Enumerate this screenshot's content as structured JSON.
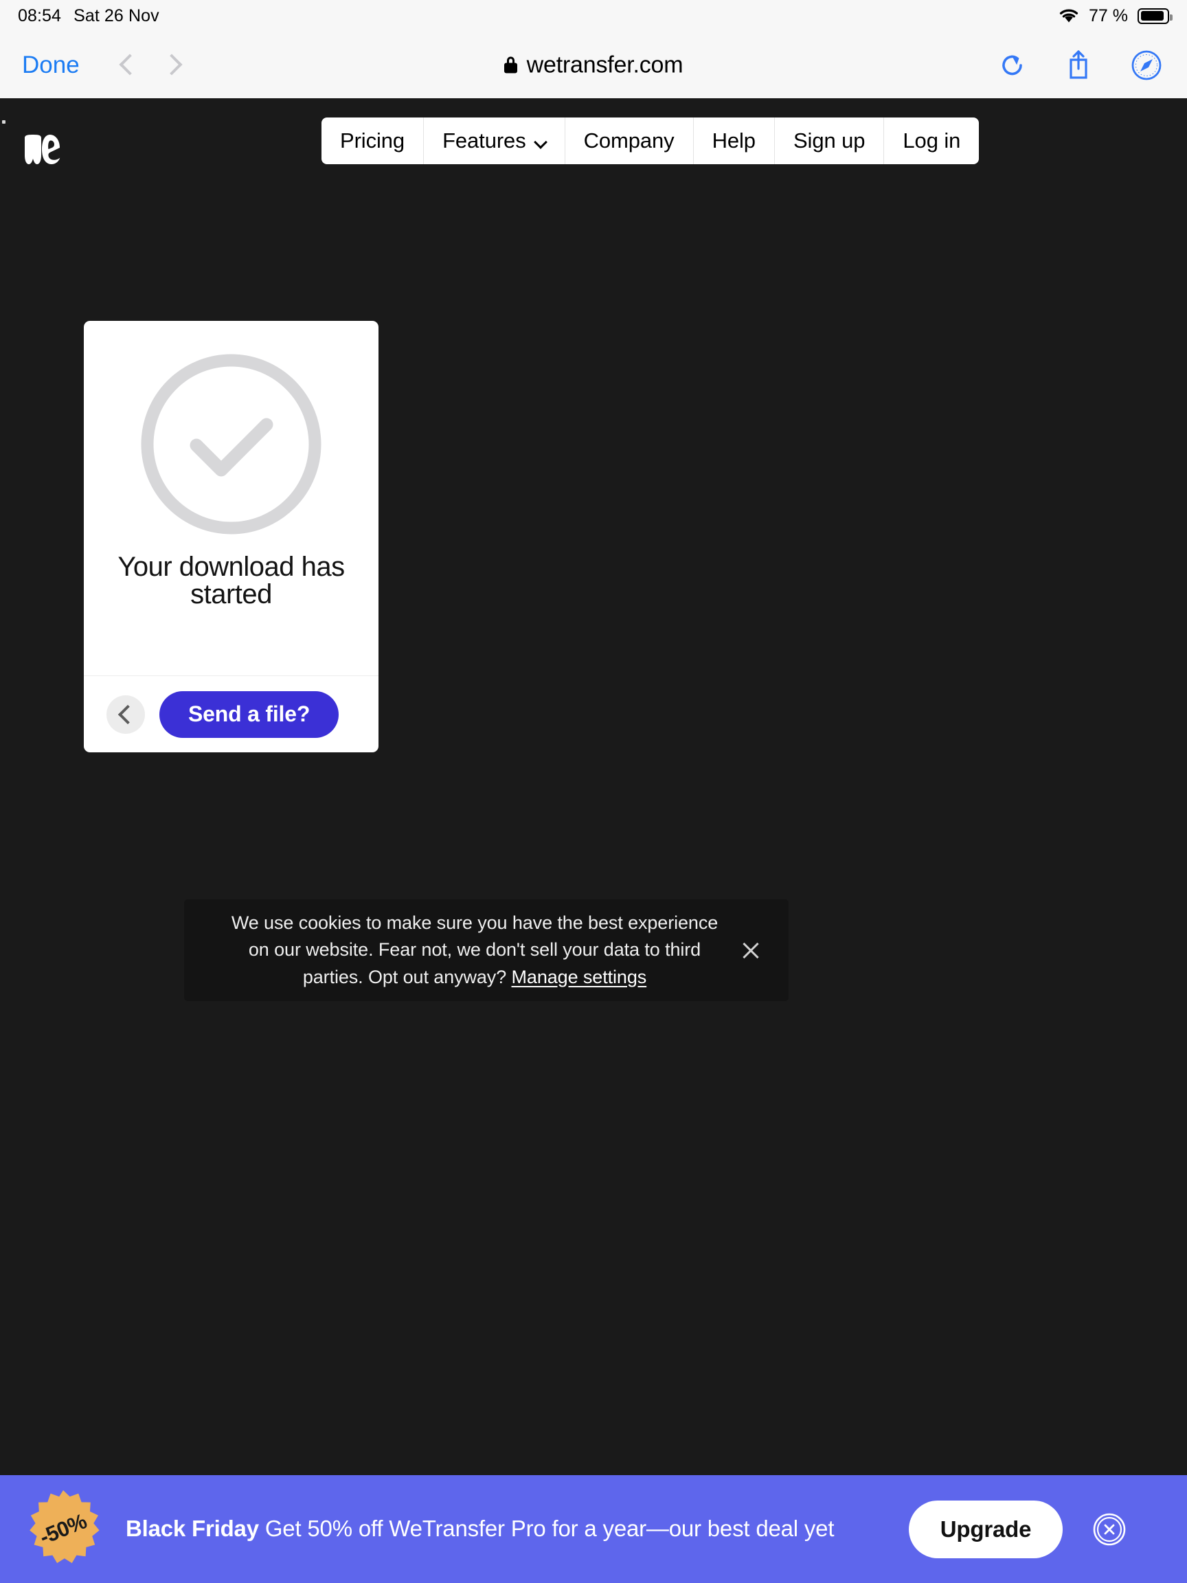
{
  "status_bar": {
    "time": "08:54",
    "date": "Sat 26 Nov",
    "battery_percent": "77 %",
    "wifi_icon": "wifi-icon",
    "battery_icon": "battery-icon"
  },
  "browser": {
    "done_label": "Done",
    "back_icon": "chevron-left-icon",
    "forward_icon": "chevron-right-icon",
    "lock_icon": "lock-icon",
    "url": "wetransfer.com",
    "reload_icon": "reload-icon",
    "share_icon": "share-icon",
    "tabs_icon": "safari-compass-icon"
  },
  "site": {
    "logo_name": "wetransfer-logo",
    "nav": [
      {
        "label": "Pricing",
        "has_caret": false
      },
      {
        "label": "Features",
        "has_caret": true
      },
      {
        "label": "Company",
        "has_caret": false
      },
      {
        "label": "Help",
        "has_caret": false
      },
      {
        "label": "Sign up",
        "has_caret": false
      },
      {
        "label": "Log in",
        "has_caret": false
      }
    ],
    "background_color": "#1a1a1a"
  },
  "card": {
    "status_icon": "check-circle-icon",
    "title_line1": "Your download has",
    "title_line2": "started",
    "back_icon": "chevron-left-icon",
    "primary_button": "Send a file?",
    "primary_button_color": "#3b30d6",
    "check_color": "#d7d7d9"
  },
  "cookie_banner": {
    "text_line1": "We use cookies to make sure you have the best experience on our website. Fear",
    "text_line2_prefix": "not, we don't sell your data to third parties. Opt out anyway? ",
    "manage_link": "Manage settings",
    "close_icon": "close-icon"
  },
  "promo_banner": {
    "badge_text": "-50%",
    "badge_color": "#eeb058",
    "background_color": "#5e66ec",
    "headline_bold": "Black Friday",
    "headline_rest": " Get 50% off WeTransfer Pro for a year—our best deal yet",
    "cta_label": "Upgrade",
    "close_icon": "close-circle-icon"
  }
}
